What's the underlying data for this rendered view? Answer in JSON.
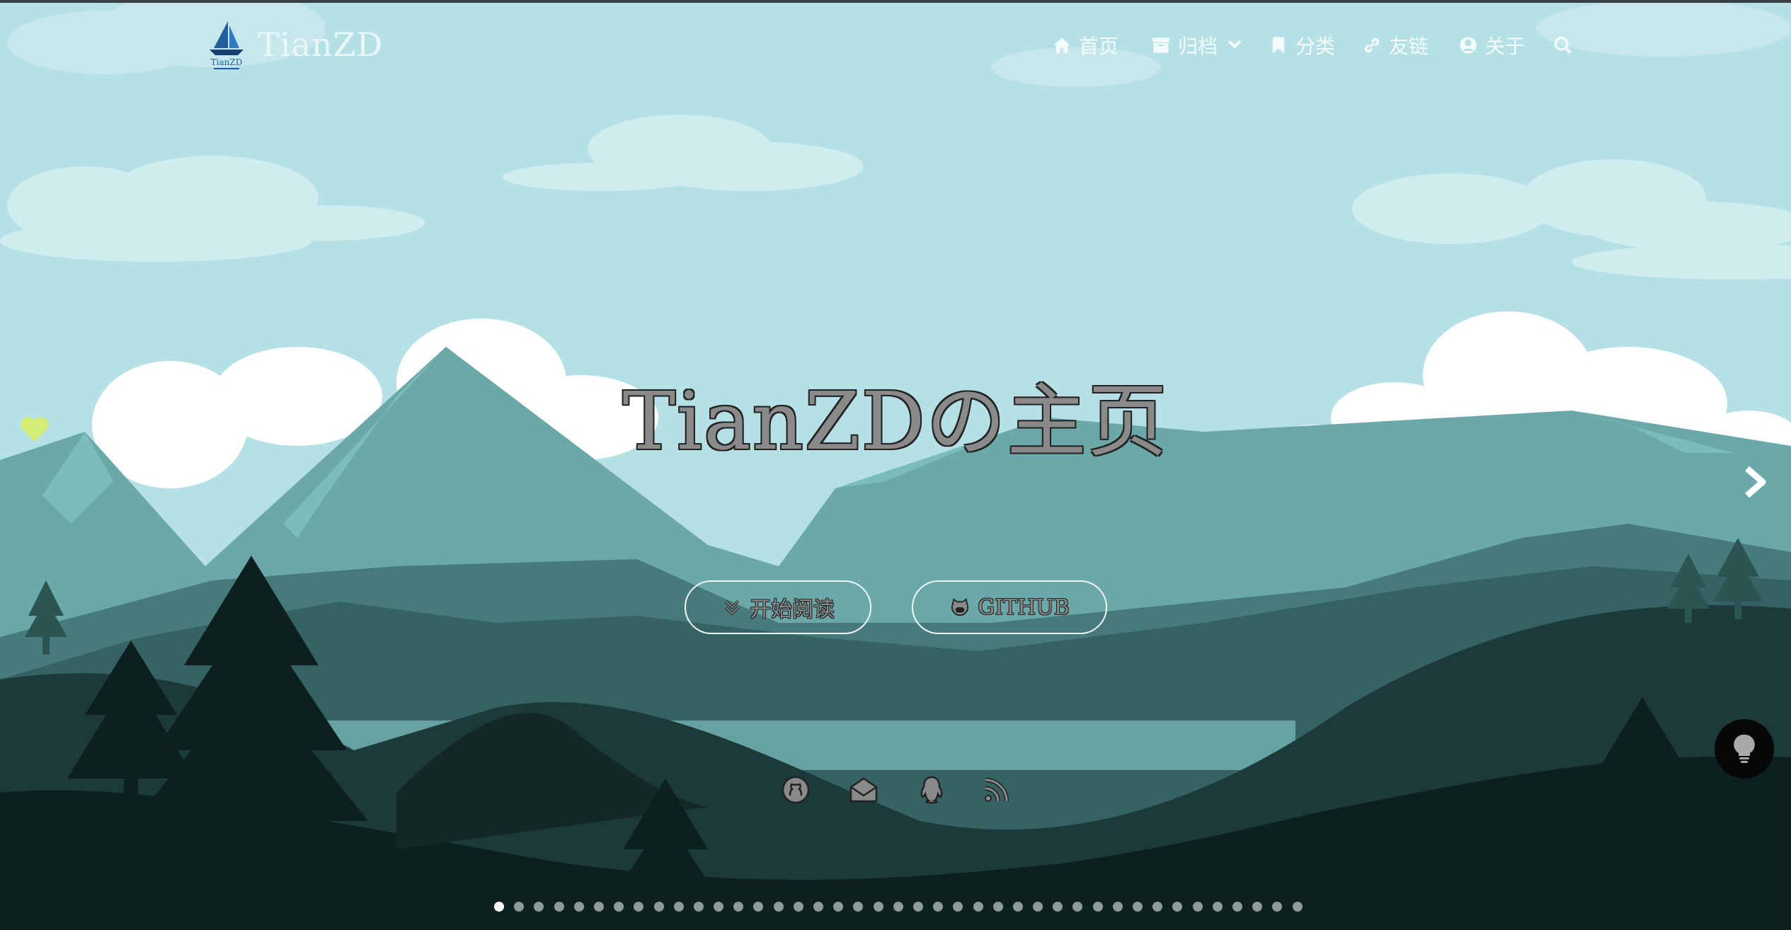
{
  "site": {
    "brand": "TianZD",
    "logo_label": "TianZD"
  },
  "nav": {
    "home": "首页",
    "archive": "归档",
    "category": "分类",
    "links": "友链",
    "about": "关于"
  },
  "hero": {
    "title": "TianZDの主页",
    "read_button": "开始阅读",
    "github_button": "GITHUB"
  },
  "icons": {
    "social": [
      "github-icon",
      "mail-icon",
      "qq-icon",
      "rss-icon"
    ]
  },
  "carousel": {
    "slide_count": 41,
    "active_index": 0
  },
  "colors": {
    "sky": "#b4e0e6",
    "mountain_far": "#6aa8a9",
    "mountain_mid": "#356263",
    "forest_dark": "#0d1f1e"
  }
}
